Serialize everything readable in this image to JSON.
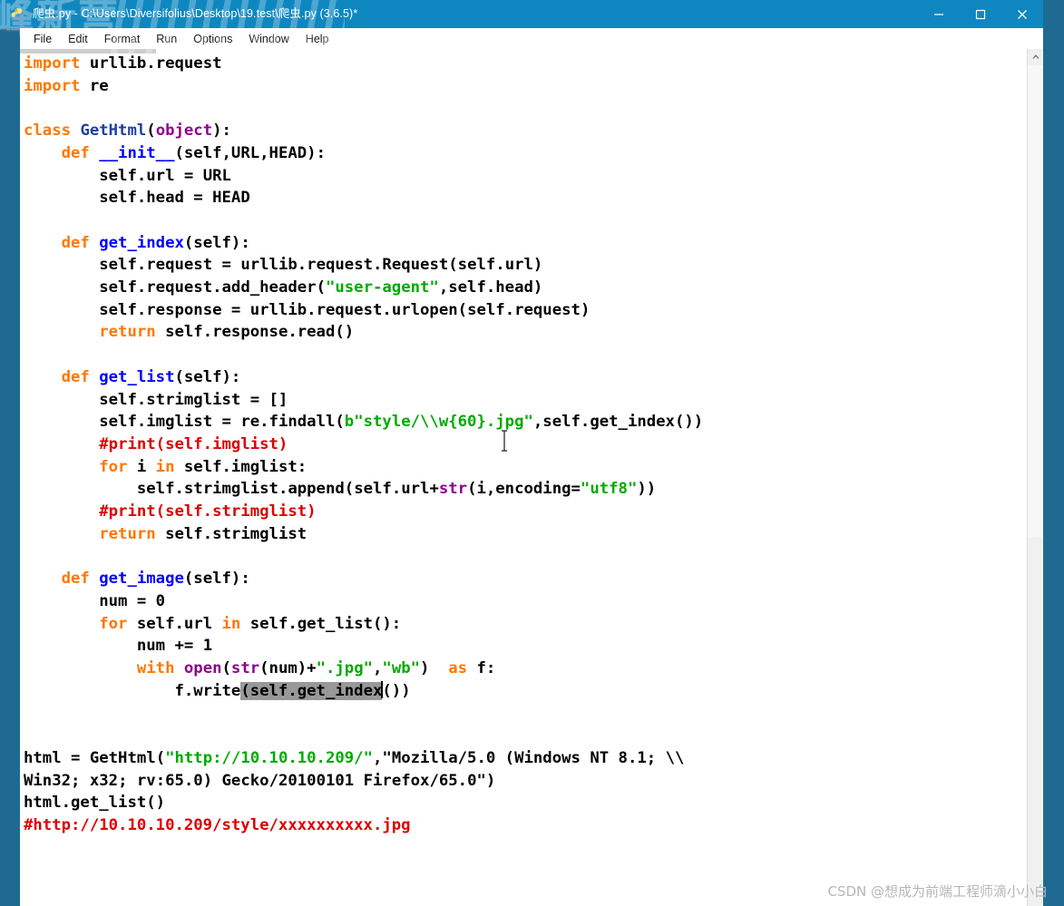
{
  "window": {
    "title": "爬虫.py - C:\\Users\\Diversifolius\\Desktop\\19.test\\爬虫.py (3.6.5)*",
    "app_icon": "python-idle-icon",
    "accent_color": "#0e87c0",
    "desktop_color": "#1f6a93",
    "controls": {
      "minimize_label": "—",
      "maximize_label": "□",
      "close_label": "✕"
    }
  },
  "menubar": {
    "items": [
      {
        "label": "File"
      },
      {
        "label": "Edit"
      },
      {
        "label": "Format"
      },
      {
        "label": "Run"
      },
      {
        "label": "Options"
      },
      {
        "label": "Window"
      },
      {
        "label": "Help"
      }
    ]
  },
  "editor": {
    "colors": {
      "keyword": "#ff7700",
      "definition": "#0000ff",
      "class_name": "#2040a0",
      "builtin": "#900090",
      "string": "#00aa00",
      "comment": "#dd0000",
      "plain": "#000000",
      "selection": "#999999",
      "background": "#ffffff"
    },
    "selection_text": "(self.get_index",
    "code_lines": [
      "import urllib.request",
      "import re",
      "",
      "class GetHtml(object):",
      "    def __init__(self,URL,HEAD):",
      "        self.url = URL",
      "        self.head = HEAD",
      "",
      "    def get_index(self):",
      "        self.request = urllib.request.Request(self.url)",
      "        self.request.add_header(\"user-agent\",self.head)",
      "        self.response = urllib.request.urlopen(self.request)",
      "        return self.response.read()",
      "",
      "    def get_list(self):",
      "        self.strimglist = []",
      "        self.imglist = re.findall(b\"style/\\\\w{60}.jpg\",self.get_index())",
      "        #print(self.imglist)",
      "        for i in self.imglist:",
      "            self.strimglist.append(self.url+str(i,encoding=\"utf8\"))",
      "        #print(self.strimglist)",
      "        return self.strimglist",
      "",
      "    def get_image(self):",
      "        num = 0",
      "        for self.url in self.get_list():",
      "            num += 1",
      "            with open(str(num)+\".jpg\",\"wb\")  as f:",
      "                f.write(self.get_index())",
      "",
      "",
      "html = GetHtml(\"http://10.10.10.209/\",\"Mozilla/5.0 (Windows NT 8.1; \\\\",
      "Win32; x32; rv:65.0) Gecko/20100101 Firefox/65.0\")",
      "html.get_list()",
      "#http://10.10.10.209/style/xxxxxxxxxx.jpg"
    ]
  },
  "scrollbar": {
    "up_arrow_icon": "chevron-up-icon"
  },
  "watermarks": {
    "ghost_text": "峰新营",
    "csdn": "CSDN @想成为前端工程师滴小小白"
  }
}
